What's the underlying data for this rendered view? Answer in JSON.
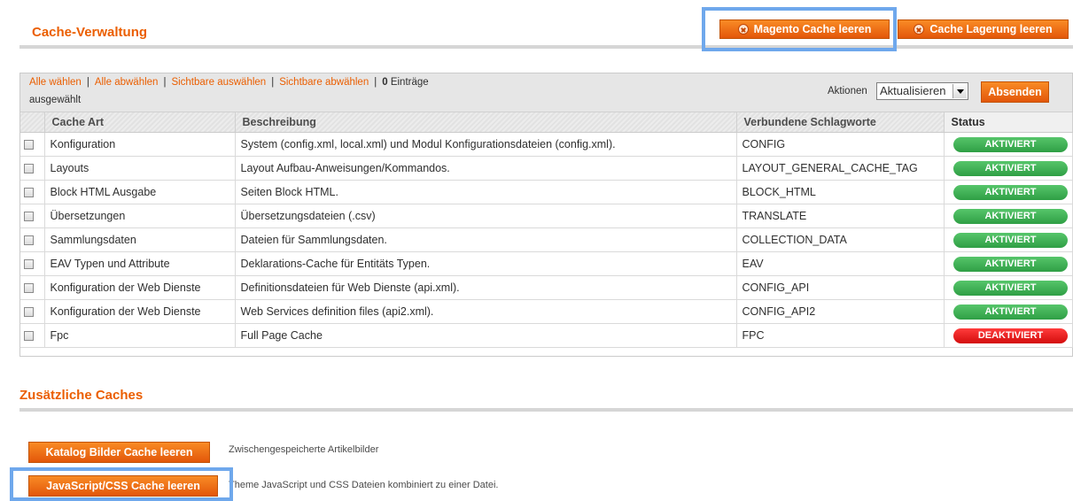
{
  "header": {
    "title": "Cache-Verwaltung",
    "flush_magento_label": "Magento Cache leeren",
    "flush_storage_label": "Cache Lagerung leeren"
  },
  "massaction": {
    "select_all": "Alle wählen",
    "unselect_all": "Alle abwählen",
    "select_visible": "Sichtbare auswählen",
    "unselect_visible": "Sichtbare abwählen",
    "count": "0",
    "count_suffix": "Einträge",
    "count_line2": "ausgewählt",
    "actions_label": "Aktionen",
    "action_selected": "Aktualisieren",
    "submit_label": "Absenden"
  },
  "table": {
    "columns": [
      "Cache Art",
      "Beschreibung",
      "Verbundene Schlagworte",
      "Status"
    ],
    "rows": [
      {
        "type": "Konfiguration",
        "description": "System (config.xml, local.xml) und Modul Konfigurationsdateien (config.xml).",
        "tags": "CONFIG",
        "status": "AKTIVIERT"
      },
      {
        "type": "Layouts",
        "description": "Layout Aufbau-Anweisungen/Kommandos.",
        "tags": "LAYOUT_GENERAL_CACHE_TAG",
        "status": "AKTIVIERT"
      },
      {
        "type": "Block HTML Ausgabe",
        "description": "Seiten Block HTML.",
        "tags": "BLOCK_HTML",
        "status": "AKTIVIERT"
      },
      {
        "type": "Übersetzungen",
        "description": "Übersetzungsdateien (.csv)",
        "tags": "TRANSLATE",
        "status": "AKTIVIERT"
      },
      {
        "type": "Sammlungsdaten",
        "description": "Dateien für Sammlungsdaten.",
        "tags": "COLLECTION_DATA",
        "status": "AKTIVIERT"
      },
      {
        "type": "EAV Typen und Attribute",
        "description": "Deklarations-Cache für Entitäts Typen.",
        "tags": "EAV",
        "status": "AKTIVIERT"
      },
      {
        "type": "Konfiguration der Web Dienste",
        "description": "Definitionsdateien für Web Dienste (api.xml).",
        "tags": "CONFIG_API",
        "status": "AKTIVIERT"
      },
      {
        "type": "Konfiguration der Web Dienste",
        "description": "Web Services definition files (api2.xml).",
        "tags": "CONFIG_API2",
        "status": "AKTIVIERT"
      },
      {
        "type": "Fpc",
        "description": "Full Page Cache",
        "tags": "FPC",
        "status": "DEAKTIVIERT"
      }
    ]
  },
  "additional": {
    "title": "Zusätzliche Caches",
    "catalog_images_button": "Katalog Bilder Cache leeren",
    "catalog_images_note": "Zwischengespeicherte Artikelbilder",
    "js_css_button": "JavaScript/CSS Cache leeren",
    "js_css_note": "Theme JavaScript und CSS Dateien kombiniert zu einer Datei."
  },
  "colors": {
    "accent": "#eb5e00",
    "enabled": "#3dae52",
    "disabled": "#e01717",
    "highlight": "#6fa8ec"
  }
}
